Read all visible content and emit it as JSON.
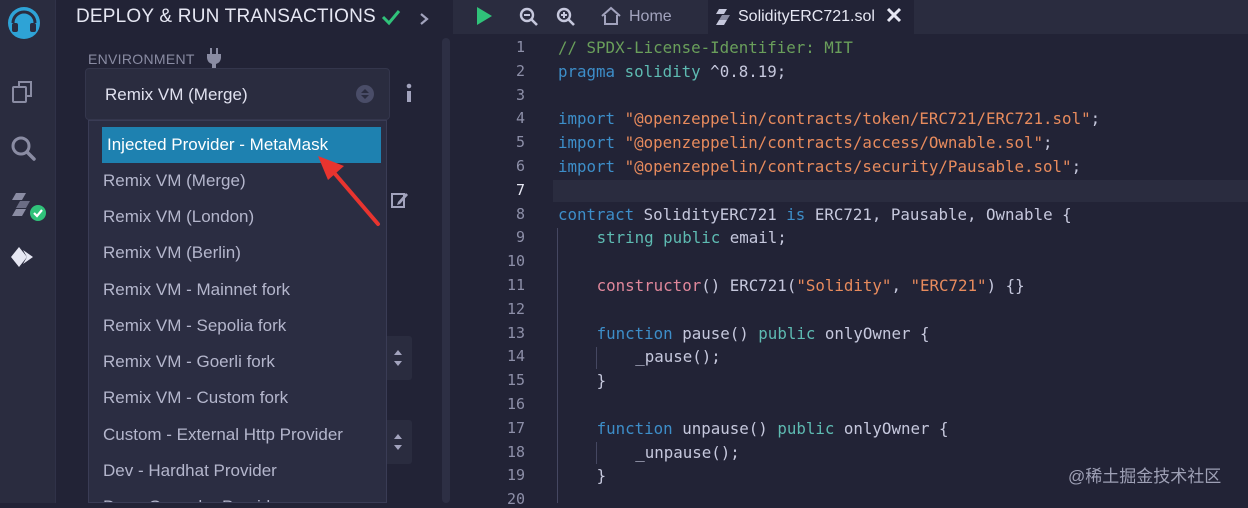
{
  "panel": {
    "title": "DEPLOY & RUN TRANSACTIONS",
    "environment_label": "ENVIRONMENT",
    "environment_selected": "Remix VM (Merge)"
  },
  "dropdown": {
    "items": [
      "Injected Provider - MetaMask",
      "Remix VM (Merge)",
      "Remix VM (London)",
      "Remix VM (Berlin)",
      "Remix VM - Mainnet fork",
      "Remix VM - Sepolia fork",
      "Remix VM - Goerli fork",
      "Remix VM - Custom fork",
      "Custom - External Http Provider",
      "Dev - Hardhat Provider",
      "Dev - Ganache Provider"
    ],
    "selected_index": 0
  },
  "tabs": {
    "home_label": "Home",
    "file_label": "SolidityERC721.sol"
  },
  "editor": {
    "line_numbers": [
      "1",
      "2",
      "3",
      "4",
      "5",
      "6",
      "7",
      "8",
      "9",
      "10",
      "11",
      "12",
      "13",
      "14",
      "15",
      "16",
      "17",
      "18",
      "19",
      "20"
    ],
    "active_line": 7,
    "lines": [
      {
        "n": 1,
        "indent": 0,
        "parts": [
          {
            "c": "cm",
            "t": "// SPDX-License-Identifier: MIT"
          }
        ]
      },
      {
        "n": 2,
        "indent": 0,
        "parts": [
          {
            "c": "kw",
            "t": "pragma "
          },
          {
            "c": "ty",
            "t": "solidity"
          },
          {
            "c": "",
            "t": " ^0.8.19;"
          }
        ]
      },
      {
        "n": 3,
        "indent": 0,
        "parts": []
      },
      {
        "n": 4,
        "indent": 0,
        "parts": [
          {
            "c": "kw",
            "t": "import "
          },
          {
            "c": "st",
            "t": "\"@openzeppelin/contracts/token/ERC721/ERC721.sol\""
          },
          {
            "c": "",
            "t": ";"
          }
        ]
      },
      {
        "n": 5,
        "indent": 0,
        "parts": [
          {
            "c": "kw",
            "t": "import "
          },
          {
            "c": "st",
            "t": "\"@openzeppelin/contracts/access/Ownable.sol\""
          },
          {
            "c": "",
            "t": ";"
          }
        ]
      },
      {
        "n": 6,
        "indent": 0,
        "parts": [
          {
            "c": "kw",
            "t": "import "
          },
          {
            "c": "st",
            "t": "\"@openzeppelin/contracts/security/Pausable.sol\""
          },
          {
            "c": "",
            "t": ";"
          }
        ]
      },
      {
        "n": 7,
        "indent": 0,
        "parts": []
      },
      {
        "n": 8,
        "indent": 0,
        "parts": [
          {
            "c": "kw",
            "t": "contract "
          },
          {
            "c": "",
            "t": "SolidityERC721 "
          },
          {
            "c": "kw",
            "t": "is "
          },
          {
            "c": "",
            "t": "ERC721, Pausable, Ownable {"
          }
        ]
      },
      {
        "n": 9,
        "indent": 1,
        "parts": [
          {
            "c": "ty",
            "t": "string "
          },
          {
            "c": "ty",
            "t": "public "
          },
          {
            "c": "",
            "t": "email;"
          }
        ]
      },
      {
        "n": 10,
        "indent": 1,
        "parts": []
      },
      {
        "n": 11,
        "indent": 1,
        "parts": [
          {
            "c": "fn",
            "t": "constructor"
          },
          {
            "c": "",
            "t": "() ERC721("
          },
          {
            "c": "st",
            "t": "\"Solidity\""
          },
          {
            "c": "",
            "t": ", "
          },
          {
            "c": "st",
            "t": "\"ERC721\""
          },
          {
            "c": "",
            "t": ") {}"
          }
        ]
      },
      {
        "n": 12,
        "indent": 1,
        "parts": []
      },
      {
        "n": 13,
        "indent": 1,
        "parts": [
          {
            "c": "kw",
            "t": "function "
          },
          {
            "c": "",
            "t": "pause() "
          },
          {
            "c": "ty",
            "t": "public "
          },
          {
            "c": "",
            "t": "onlyOwner {"
          }
        ]
      },
      {
        "n": 14,
        "indent": 2,
        "parts": [
          {
            "c": "",
            "t": "_pause();"
          }
        ]
      },
      {
        "n": 15,
        "indent": 1,
        "parts": [
          {
            "c": "",
            "t": "}"
          }
        ]
      },
      {
        "n": 16,
        "indent": 1,
        "parts": []
      },
      {
        "n": 17,
        "indent": 1,
        "parts": [
          {
            "c": "kw",
            "t": "function "
          },
          {
            "c": "",
            "t": "unpause() "
          },
          {
            "c": "ty",
            "t": "public "
          },
          {
            "c": "",
            "t": "onlyOwner {"
          }
        ]
      },
      {
        "n": 18,
        "indent": 2,
        "parts": [
          {
            "c": "",
            "t": "_unpause();"
          }
        ]
      },
      {
        "n": 19,
        "indent": 1,
        "parts": [
          {
            "c": "",
            "t": "}"
          }
        ]
      },
      {
        "n": 20,
        "indent": 0,
        "parts": []
      }
    ]
  },
  "watermark": "@稀土掘金技术社区",
  "colors": {
    "accent": "#1e81b0",
    "success": "#30c27a",
    "annotation_arrow": "#e8342f"
  },
  "icons": {
    "rail": [
      "remix-logo-icon",
      "file-explorer-icon",
      "search-icon",
      "solidity-compiler-icon",
      "deploy-run-icon"
    ],
    "toolbar": [
      "run-icon",
      "zoom-out-icon",
      "zoom-in-icon",
      "home-icon"
    ]
  }
}
